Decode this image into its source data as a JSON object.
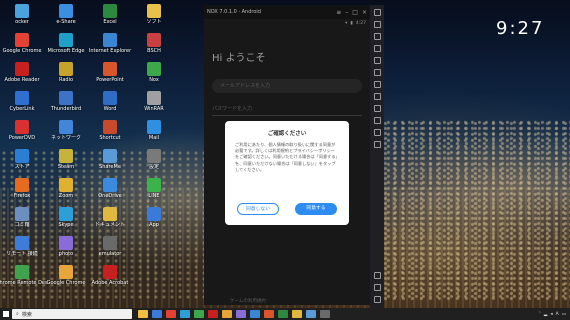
{
  "clock": "9:27",
  "desktop_icons": [
    {
      "label": "ocker",
      "color": "#4aa3df"
    },
    {
      "label": "Google Chrome",
      "color": "#e34133"
    },
    {
      "label": "Adobe Reader",
      "color": "#c81f1f"
    },
    {
      "label": "CyberLink",
      "color": "#2f6fd0"
    },
    {
      "label": "PowerDVD",
      "color": "#d93030"
    },
    {
      "label": "ストア",
      "color": "#2a7fd4"
    },
    {
      "label": "Firefox",
      "color": "#e66a1f"
    },
    {
      "label": "ゴミ箱",
      "color": "#6a8fc0"
    },
    {
      "label": "リモート 接続",
      "color": "#3b7dd8"
    },
    {
      "label": "Chrome Remote Desktop",
      "color": "#3fa34d"
    },
    {
      "label": "e-Share",
      "color": "#3c8ee0"
    },
    {
      "label": "Microsoft Edge",
      "color": "#1fa0c8"
    },
    {
      "label": "Radio",
      "color": "#c8a32a"
    },
    {
      "label": "Thunderbird",
      "color": "#3d72c6"
    },
    {
      "label": "ネットワーク",
      "color": "#4186d8"
    },
    {
      "label": "Steam",
      "color": "#c8b23a"
    },
    {
      "label": "Zoom",
      "color": "#e0b030"
    },
    {
      "label": "Skype",
      "color": "#2e9fd6"
    },
    {
      "label": "photo",
      "color": "#8a6cd8"
    },
    {
      "label": "Google Chrome",
      "color": "#e8a53a"
    },
    {
      "label": "Excel",
      "color": "#2b8a3e"
    },
    {
      "label": "Internet Explorer",
      "color": "#3a86d4"
    },
    {
      "label": "PowerPoint",
      "color": "#d9562a"
    },
    {
      "label": "Word",
      "color": "#2f6cc4"
    },
    {
      "label": "Shortcut",
      "color": "#c84a2a"
    },
    {
      "label": "ShareMe",
      "color": "#5a9ad8"
    },
    {
      "label": "OneDrive",
      "color": "#3a8ae0"
    },
    {
      "label": "ドキュメント",
      "color": "#e0b840"
    },
    {
      "label": "emulator",
      "color": "#6a6a6a"
    },
    {
      "label": "Adobe Acrobat",
      "color": "#c81f1f"
    },
    {
      "label": "ソフト",
      "color": "#e8c04a"
    },
    {
      "label": "BSCH",
      "color": "#c84040"
    },
    {
      "label": "Nox",
      "color": "#3da84a"
    },
    {
      "label": "WinRAR",
      "color": "#a0a0a0"
    },
    {
      "label": "Mail",
      "color": "#2f8fe0"
    },
    {
      "label": "設定",
      "color": "#7a7a7a"
    },
    {
      "label": "LINE",
      "color": "#3cb34a"
    },
    {
      "label": "App",
      "color": "#3a7ad8"
    }
  ],
  "emulator": {
    "title": "NOX 7.0.1.0 · Android",
    "greeting": "Hi ようこそ",
    "email_placeholder": "メールアドレスを入力",
    "password_placeholder": "パスワードを入力",
    "bottom_link": "ゲームの利用規約",
    "status": "4:27"
  },
  "dialog": {
    "title": "ご確認ください",
    "body": "ご利用にあたり、個人情報の取り扱いに関する同意が必要です。詳しくは利用規約とプライバシーポリシーをご確認ください。同意いただける場合は「同意する」を、同意いただけない場合は「同意しない」をタップしてください。",
    "decline": "同意しない",
    "accept": "同意する"
  },
  "taskbar": {
    "search_placeholder": "検索",
    "icon_colors": [
      "#f0c040",
      "#3a7ad8",
      "#e34133",
      "#2e9fd6",
      "#3da84a",
      "#c81f1f",
      "#e8a53a",
      "#8a6cd8",
      "#3a86d4",
      "#d9562a",
      "#2b8a3e",
      "#e0b840",
      "#5a9ad8",
      "#6a6a6a"
    ]
  }
}
